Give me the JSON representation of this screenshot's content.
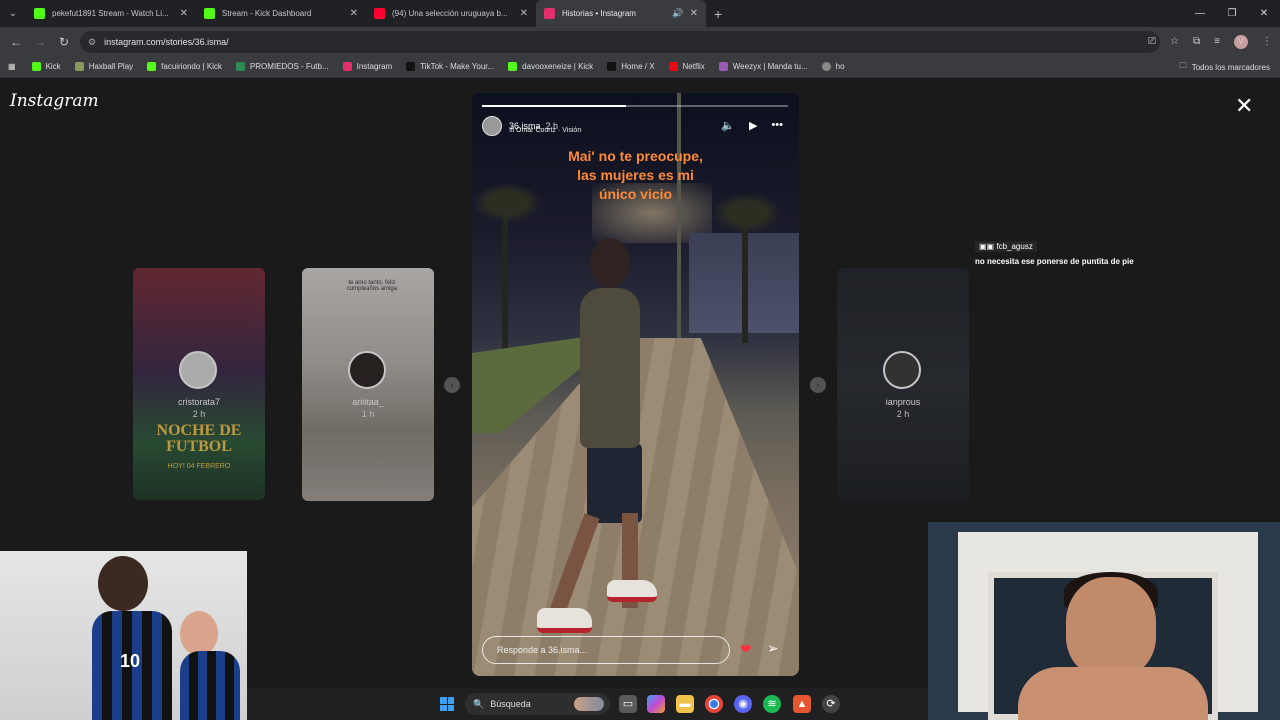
{
  "browser": {
    "tabs": [
      {
        "title": "pekefut1891 Stream - Watch Li...",
        "favicon_color": "#53fc18"
      },
      {
        "title": "Stream - Kick Dashboard",
        "favicon_color": "#53fc18"
      },
      {
        "title": "(94) Una selección uruguaya b...",
        "favicon_color": "#ff0033"
      },
      {
        "title": "Historias • Instagram",
        "favicon_color": "#e1306c",
        "active": true
      }
    ],
    "new_tab": "+",
    "url": "instagram.com/stories/36.isma/",
    "bookmarks": [
      {
        "label": "Kick",
        "color": "#53fc18"
      },
      {
        "label": "Haxball Play",
        "color": "#8a9a5b"
      },
      {
        "label": "facuiriondo | Kick",
        "color": "#53fc18"
      },
      {
        "label": "PROMIEDOS - Futb...",
        "color": "#2e8b57"
      },
      {
        "label": "Instagram",
        "color": "#e1306c"
      },
      {
        "label": "TikTok - Make Your...",
        "color": "#111111"
      },
      {
        "label": "davooxeneize | Kick",
        "color": "#53fc18"
      },
      {
        "label": "Home / X",
        "color": "#111111"
      },
      {
        "label": "Netflix",
        "color": "#e50914"
      },
      {
        "label": "Weezyx | Manda tu...",
        "color": "#9b59b6"
      },
      {
        "label": "ho",
        "color": "#888888"
      }
    ],
    "all_bookmarks": "Todos los marcadores",
    "profile_initial": "V"
  },
  "instagram": {
    "logo": "Instagram",
    "close_icon": "close-icon",
    "main_story": {
      "username": "36.isma",
      "time": "2 h",
      "music": "Omar Courtz · Visión",
      "caption_lines": [
        "Mai' no te preocupe,",
        "las mujeres es mi",
        "único vicio"
      ],
      "caption_color": "#ff8a34",
      "progress": 0.47,
      "reply_placeholder": "Responde a 36.isma..."
    },
    "side_stories": [
      {
        "username": "cristorata7",
        "time": "2 h",
        "poster_title": "NOCHE DE FUTBOL",
        "poster_sub": "HOY! 04 FEBRERO"
      },
      {
        "username": "ariiitaa_",
        "time": "1 h",
        "poster_text": "te amo tanto, feliz cumpleaños amiga"
      },
      {
        "username": "ianprous",
        "time": "2 h"
      }
    ]
  },
  "stream_overlay": {
    "chat_user": "fcb_agusz",
    "chat_message": "no necesita ese ponerse de puntita de pie",
    "jersey_number": "10"
  },
  "taskbar": {
    "search_label": "Búsqueda"
  }
}
